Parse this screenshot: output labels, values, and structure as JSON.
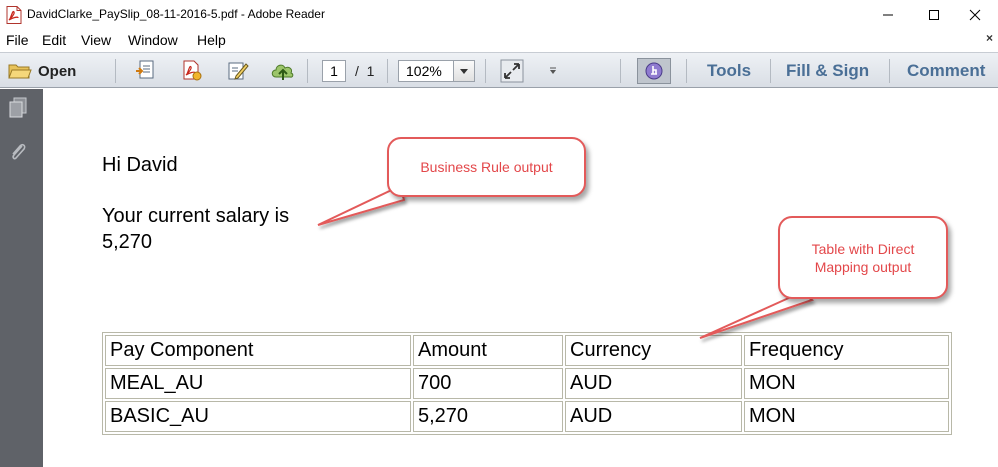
{
  "window": {
    "title": "DavidClarke_PaySlip_08-11-2016-5.pdf - Adobe Reader"
  },
  "menu": {
    "items": [
      "File",
      "Edit",
      "View",
      "Window",
      "Help"
    ],
    "close_doc": "×"
  },
  "toolbar": {
    "open_label": "Open",
    "current_page": "1",
    "page_separator": "/",
    "total_pages": "1",
    "zoom": "102%",
    "tools_label": "Tools",
    "fill_sign_label": "Fill & Sign",
    "comment_label": "Comment"
  },
  "document": {
    "greeting": "Hi David",
    "salary_line": "Your current salary is",
    "salary_value": "5,270",
    "table": {
      "headers": [
        "Pay Component",
        "Amount",
        "Currency",
        "Frequency"
      ],
      "rows": [
        [
          "MEAL_AU",
          "700",
          "AUD",
          "MON"
        ],
        [
          "BASIC_AU",
          "5,270",
          "AUD",
          "MON"
        ]
      ]
    }
  },
  "annotations": {
    "business_rule": "Business Rule output",
    "table_line1": "Table with Direct",
    "table_line2": "Mapping output"
  },
  "colors": {
    "callout_red": "#e3474a",
    "nav_blue": "#4a6f96",
    "left_pane": "#5f6268"
  }
}
